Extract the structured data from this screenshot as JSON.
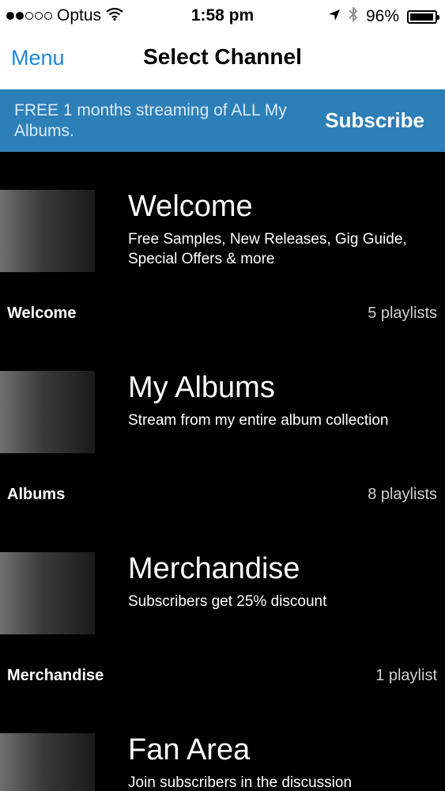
{
  "status": {
    "carrier": "Optus",
    "time": "1:58 pm",
    "battery": "96%",
    "battery_level": 0.96,
    "signal_bars_filled": 2
  },
  "nav": {
    "menu_label": "Menu",
    "title": "Select Channel"
  },
  "promo": {
    "text": "FREE 1 months streaming of ALL My Albums.",
    "subscribe_label": "Subscribe"
  },
  "channels": [
    {
      "title": "Welcome",
      "description": "Free Samples, New Releases, Gig Guide, Special Offers & more",
      "name": "Welcome",
      "count": "5 playlists"
    },
    {
      "title": "My Albums",
      "description": "Stream from my entire album collection",
      "name": "Albums",
      "count": "8 playlists"
    },
    {
      "title": "Merchandise",
      "description": "Subscribers get 25% discount",
      "name": "Merchandise",
      "count": "1 playlist"
    },
    {
      "title": "Fan Area",
      "description": "Join subscribers in the discussion",
      "name": "",
      "count": ""
    }
  ],
  "colors": {
    "accent": "#1e87d6",
    "promo_bg": "#2d7fb8",
    "list_bg": "#000000"
  }
}
